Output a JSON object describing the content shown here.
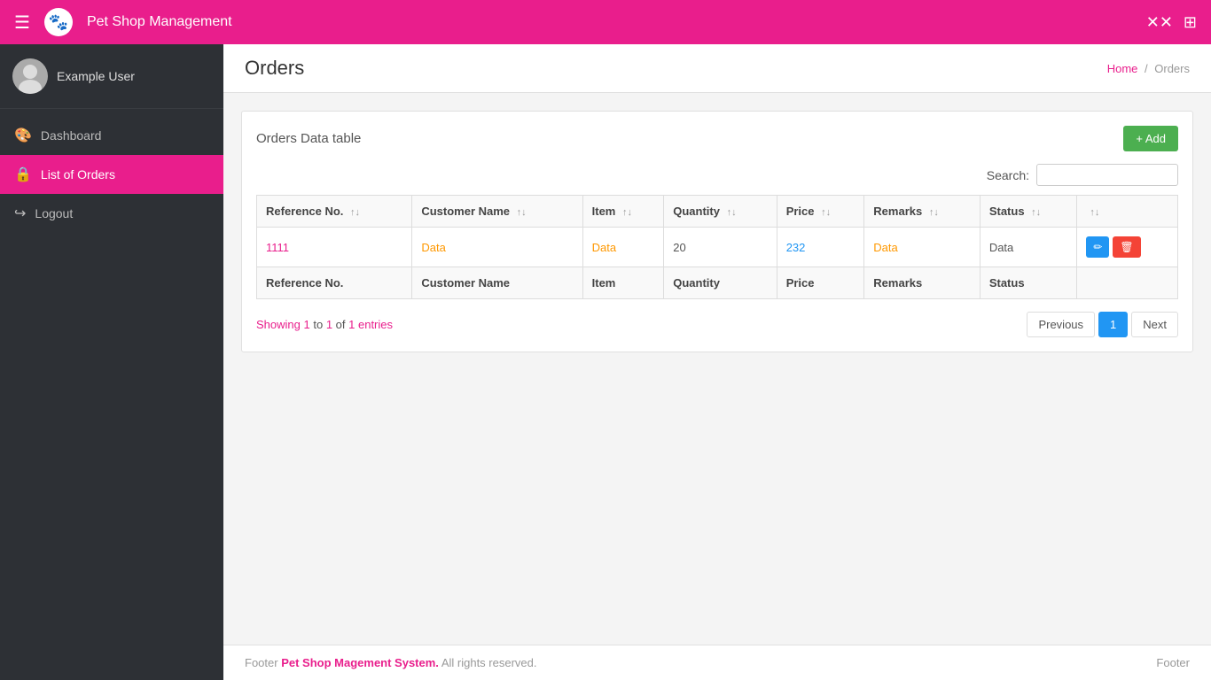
{
  "app": {
    "title": "Pet Shop Management",
    "logo_icon": "🐾"
  },
  "topnav": {
    "hamburger_icon": "☰",
    "compress_icon": "⤢",
    "grid_icon": "⊞"
  },
  "sidebar": {
    "username": "Example User",
    "items": [
      {
        "id": "dashboard",
        "label": "Dashboard",
        "icon": "🎨",
        "active": false
      },
      {
        "id": "list-of-orders",
        "label": "List of Orders",
        "icon": "🔒",
        "active": true
      },
      {
        "id": "logout",
        "label": "Logout",
        "icon": "↪",
        "active": false
      }
    ]
  },
  "breadcrumb": {
    "home": "Home",
    "separator": "/",
    "current": "Orders"
  },
  "page": {
    "title": "Orders"
  },
  "card": {
    "title": "Orders Data table",
    "add_button_label": "+ Add"
  },
  "search": {
    "label": "Search:",
    "placeholder": ""
  },
  "table": {
    "headers": [
      {
        "label": "Reference No.",
        "sortable": true
      },
      {
        "label": "Customer Name",
        "sortable": true
      },
      {
        "label": "Item",
        "sortable": true
      },
      {
        "label": "Quantity",
        "sortable": true
      },
      {
        "label": "Price",
        "sortable": true
      },
      {
        "label": "Remarks",
        "sortable": true
      },
      {
        "label": "Status",
        "sortable": true
      },
      {
        "label": "",
        "sortable": false
      }
    ],
    "rows": [
      {
        "ref_no": "1111",
        "customer_name": "Data",
        "item": "Data",
        "quantity": "20",
        "price": "232",
        "remarks": "Data",
        "status": "Data"
      }
    ],
    "footer_row": {
      "ref_no": "Reference No.",
      "customer_name": "Customer Name",
      "item": "Item",
      "quantity": "Quantity",
      "price": "Price",
      "remarks": "Remarks",
      "status": "Status"
    }
  },
  "pagination": {
    "showing_text": "Showing",
    "from": "1",
    "to": "1",
    "of": "1",
    "entries_text": "entries",
    "previous_label": "Previous",
    "next_label": "Next",
    "current_page": "1"
  },
  "footer": {
    "left_prefix": "Footer",
    "brand": "Pet Shop Magement System.",
    "rights": "All rights reserved.",
    "right": "Footer"
  }
}
